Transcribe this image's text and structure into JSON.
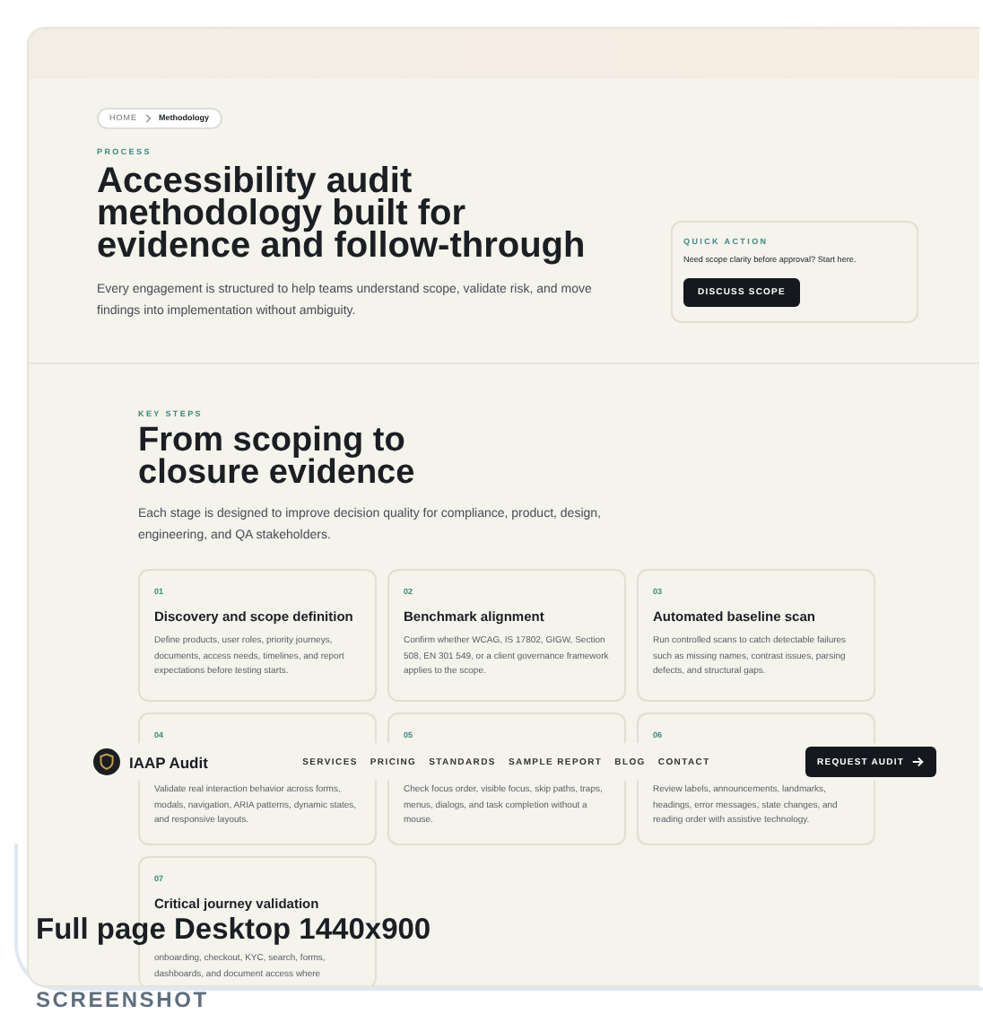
{
  "breadcrumb": [
    {
      "label": "HOME",
      "selected": false
    },
    {
      "label": "Methodology",
      "selected": true
    }
  ],
  "hero": {
    "eyebrow": "PROCESS",
    "title": "Accessibility audit methodology built for evidence and follow-through",
    "description": "Every engagement is structured to help teams understand scope, validate risk, and move findings into implementation without ambiguity."
  },
  "quick_action": {
    "eyebrow": "QUICK ACTION",
    "text": "Need scope clarity before approval? Start here.",
    "button": "DISCUSS SCOPE"
  },
  "steps": {
    "eyebrow": "KEY STEPS",
    "title": "From scoping to closure evidence",
    "description": "Each stage is designed to improve decision quality for compliance, product, design, engineering, and QA stakeholders.",
    "cards": [
      {
        "number": "01",
        "title": "Discovery and scope definition",
        "description": "Define products, user roles, priority journeys, documents, access needs, timelines, and report expectations before testing starts."
      },
      {
        "number": "02",
        "title": "Benchmark alignment",
        "description": "Confirm whether WCAG, IS 17802, GIGW, Section 508, EN 301 549, or a client governance framework applies to the scope."
      },
      {
        "number": "03",
        "title": "Automated baseline scan",
        "description": "Run controlled scans to catch detectable failures such as missing names, contrast issues, parsing defects, and structural gaps."
      },
      {
        "number": "04",
        "description": "Validate real interaction behavior across forms, modals, navigation, ARIA patterns, dynamic states, and responsive layouts."
      },
      {
        "number": "05",
        "description": "Check focus order, visible focus, skip paths, traps, menus, dialogs, and task completion without a mouse."
      },
      {
        "number": "06",
        "description": "Review labels, announcements, landmarks, headings, error messages, state changes, and reading order with assistive technology."
      },
      {
        "number": "07",
        "title": "Critical journey validation",
        "description": "onboarding, checkout, KYC, search, forms, dashboards, and document access where"
      }
    ]
  },
  "nav": {
    "brand": "IAAP Audit",
    "links": [
      "SERVICES",
      "PRICING",
      "STANDARDS",
      "SAMPLE REPORT",
      "BLOG",
      "CONTACT"
    ],
    "cta": "REQUEST AUDIT"
  },
  "caption": {
    "title": "Full page Desktop 1440x900",
    "subtitle": "SCREENSHOT"
  }
}
